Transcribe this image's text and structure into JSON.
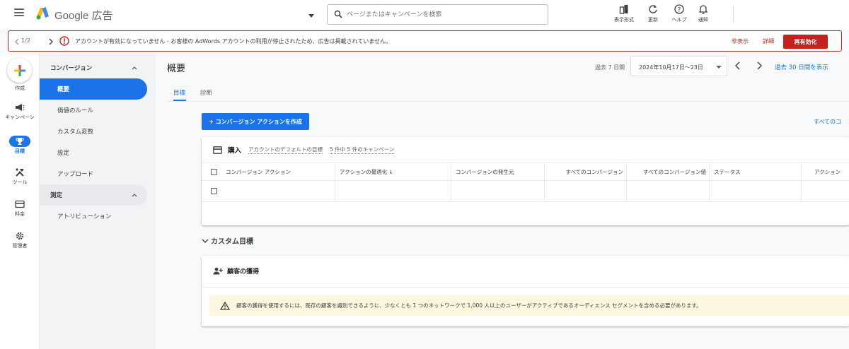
{
  "app": {
    "brand": "Google 広告"
  },
  "search": {
    "placeholder": "ページまたはキャンペーンを検索"
  },
  "toolbar": {
    "display_format": "表示形式",
    "refresh": "更新",
    "help": "ヘルプ",
    "notifications": "通知"
  },
  "alert": {
    "pagination": "1/2",
    "message": "アカウントが有効になっていません - お客様の AdWords アカウントの利用が停止されたため、広告は掲載されていません。",
    "hide": "非表示",
    "details": "詳細",
    "reactivate": "再有効化"
  },
  "rail": {
    "create": "作成",
    "campaigns": "キャンペーン",
    "goals": "目標",
    "tools": "ツール",
    "billing": "料金",
    "admin": "管理者"
  },
  "subnav": {
    "conversions_header": "コンバージョン",
    "items": [
      "概要",
      "価値のルール",
      "カスタム変数",
      "設定",
      "アップロード"
    ],
    "measurement_header": "測定",
    "measurement_items": [
      "アトリビューション"
    ]
  },
  "main": {
    "title": "概要",
    "period_label": "過去 7 日間",
    "date_range": "2024年10月17日〜23日",
    "last30": "過去 30 日間を表示",
    "tabs": [
      "目標",
      "診断"
    ],
    "create_conversion": "+ コンバージョン アクションを作成",
    "all_conversions": "すべてのコ"
  },
  "purchase_card": {
    "title": "購入",
    "default_goal": "アカウントのデフォルトの目標",
    "campaigns": "5 件中 5 件のキャンペーン",
    "columns": [
      "コンバージョン アクション",
      "アクションの最適化 ↓",
      "コンバージョンの発生元",
      "すべてのコンバージョン",
      "すべてのコンバージョン値",
      "ステータス",
      "アクション"
    ]
  },
  "custom_goals": {
    "title": "カスタム目標"
  },
  "acquisition": {
    "title": "顧客の獲得",
    "warning": "顧客の獲得を使用するには、既存の顧客を識別できるように、少なくとも 1 つのネットワークで 1,000 人以上のユーザーがアクティブであるオーディエンス セグメントを含める必要があります。"
  },
  "colors": {
    "accent": "#1a73e8",
    "error": "#c5221f",
    "warning_bg": "#fef7e0"
  }
}
